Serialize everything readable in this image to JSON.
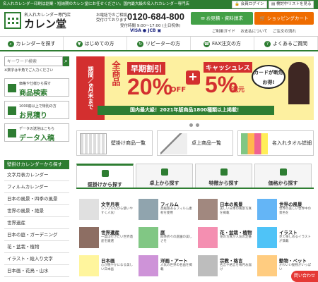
{
  "topbar": {
    "notice": "名入れカレンダー印刷は創業・短納期のカレン堂にお任せください。国内最大級の名入れカレンダー専門店",
    "login": "会員ログイン",
    "list": "検討中リストを見る"
  },
  "header": {
    "brand_sub": "名入れカレンダー専門店",
    "brand": "カレン堂",
    "tel_note1": "お電話でのご相談",
    "tel_note2": "受付けております",
    "phone": "0120-684-800",
    "hours": "受付時間 9:00～17:00 (土日祝休)",
    "btn_contact": "お見積・資料請求",
    "btn_cart": "ショッピングカート",
    "links": [
      "ご利用ガイド",
      "お支払について",
      "ご注文の流れ"
    ]
  },
  "nav": [
    {
      "icon": "search-icon",
      "label": "カレンダーを探す"
    },
    {
      "icon": "beginner-icon",
      "label": "はじめての方"
    },
    {
      "icon": "repeat-icon",
      "label": "リピーターの方"
    },
    {
      "icon": "fax-icon",
      "label": "FAX注文の方"
    },
    {
      "icon": "question-icon",
      "label": "よくあるご質問"
    }
  ],
  "search": {
    "placeholder": "キーワード検索",
    "note": "※数字は半角でご入力ください"
  },
  "side_boxes": [
    {
      "sub": "価格や仕様から探す",
      "main": "商品検索"
    },
    {
      "sub": "1000冊以上で特別の方",
      "main": "お見積り"
    },
    {
      "sub": "データの送信はこちら",
      "main": "データ入稿"
    }
  ],
  "cat_head": "壁掛けカレンダーから探す",
  "categories": [
    "文字月表カレンダー",
    "フィルムカレンダー",
    "日本の風景・四季の風景",
    "世界の風景・絶景",
    "世界遺産",
    "日本の庭・ガーデニング",
    "花・盆栽・植物",
    "イラスト・絵入り文字",
    "日本画・花鳥・山水"
  ],
  "banner": {
    "period": "期間／6月末まで",
    "all": "全商品",
    "early": "早期割引",
    "pct": "20%",
    "off": "OFF",
    "cashless": "キャッシュレス",
    "five": "5%",
    "ret": "還元",
    "bubble": "カードが断然お得!",
    "strip": "国内最大級！2021年版商品1800種類以上掲載！"
  },
  "products": [
    "壁掛け商品一覧",
    "卓上商品一覧",
    "名入れタオル詳細"
  ],
  "tabs": [
    "壁掛けから探す",
    "卓上から探す",
    "特徴から探す",
    "価格から探す"
  ],
  "grid": [
    {
      "name": "文字月表",
      "desc": "シンプルだから使いやすく人気!"
    },
    {
      "name": "フィルム",
      "desc": "高級感あるフィルム素材を使用"
    },
    {
      "name": "日本の風景",
      "desc": "美しい日本の風景写真を掲載"
    },
    {
      "name": "世界の風景",
      "desc": "世界の美しい世界中の景色を"
    },
    {
      "name": "世界遺産",
      "desc": "一度は行きたい世界遺産を厳選"
    },
    {
      "name": "庭",
      "desc": "四季折々の庭園の美しさを"
    },
    {
      "name": "花・盆栽・植物",
      "desc": "花の写真が人気の定番"
    },
    {
      "name": "イラスト",
      "desc": "見て楽しめるイラストが満載"
    },
    {
      "name": "日本画",
      "desc": "心が穏やかになる美しい日本画"
    },
    {
      "name": "洋画・アート",
      "desc": "人気の世界の名画を掲載"
    },
    {
      "name": "宗教・格言",
      "desc": "名言や格言を毎月お届け"
    },
    {
      "name": "動物・ペット",
      "desc": "かわいい動物がいっぱい"
    }
  ],
  "float_btn": "問い合わせ",
  "colors": {
    "brand": "#2e7d32",
    "accent": "#ef6c00",
    "sale": "#d32f2f"
  }
}
